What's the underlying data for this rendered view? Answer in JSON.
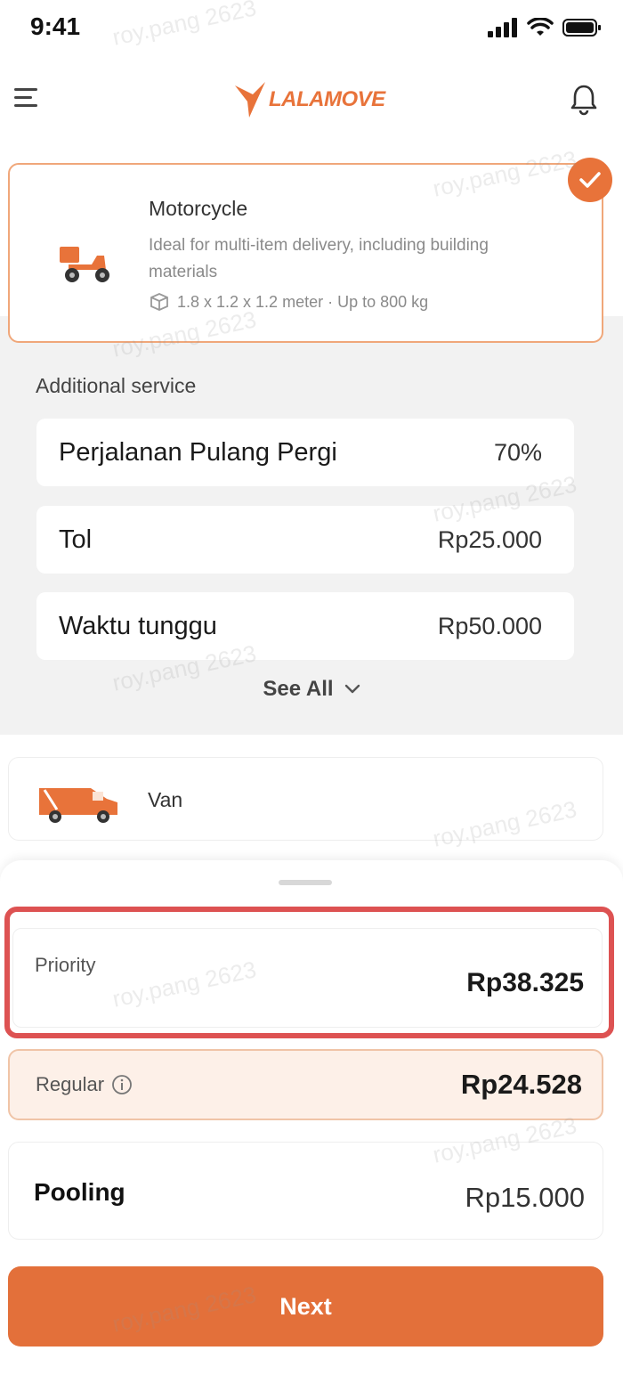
{
  "status_bar": {
    "time": "9:41",
    "icons": [
      "signal-icon",
      "wifi-icon",
      "battery-icon"
    ]
  },
  "header": {
    "logo_text": "LALAMOVE",
    "icons": [
      "menu-icon",
      "bell-icon"
    ]
  },
  "selected_vehicle": {
    "name": "Motorcycle",
    "description": "Ideal for multi-item delivery, including building materials",
    "spec": "1.8 x 1.2 x 1.2 meter · Up to 800 kg",
    "selected": true
  },
  "additional_service": {
    "title": "Additional service",
    "items": [
      {
        "label": "Perjalanan Pulang Pergi",
        "value": "70%"
      },
      {
        "label": "Tol",
        "value": "Rp25.000"
      },
      {
        "label": "Waktu tunggu",
        "value": "Rp50.000"
      }
    ],
    "see_all_label": "See All"
  },
  "other_vehicle": {
    "name": "Van"
  },
  "price_options": {
    "priority": {
      "label": "Priority",
      "price": "Rp38.325"
    },
    "regular": {
      "label": "Regular",
      "price": "Rp24.528"
    },
    "pooling": {
      "label": "Pooling",
      "price": "Rp15.000"
    }
  },
  "next_button": {
    "label": "Next"
  },
  "watermark": "roy.pang 2623",
  "colors": {
    "accent": "#e3703a",
    "highlight_outline": "#dd5252",
    "regular_bg": "#fdf0e8"
  }
}
